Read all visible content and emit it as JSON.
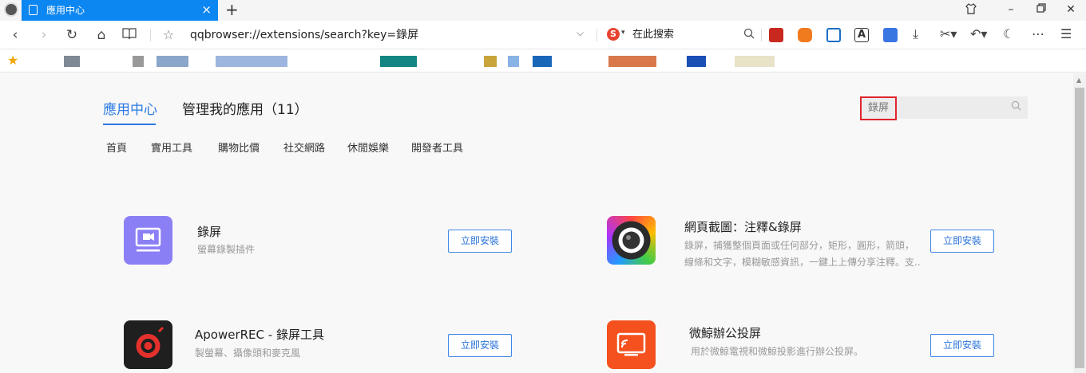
{
  "titlebar": {
    "tab_title": "應用中心",
    "tab_close": "×",
    "new_tab": "+"
  },
  "navbar": {
    "url_text": "qqbrowser://extensions/search?key=錄屏",
    "search_engine_label": "在此搜索",
    "search_engine_badge": "S"
  },
  "page": {
    "tabs": [
      {
        "label": "應用中心",
        "active": true
      },
      {
        "label": "管理我的應用（11）",
        "active": false
      }
    ],
    "search": {
      "value": "錄屏"
    },
    "categories": [
      "首頁",
      "實用工具",
      "購物比價",
      "社交網路",
      "休閒娛樂",
      "開發者工具"
    ],
    "install_label": "立即安裝",
    "apps": [
      {
        "title": "錄屏",
        "desc": [
          "螢幕錄製插件"
        ],
        "icon": "screen-record-icon",
        "icon_color": "#8b7ff5"
      },
      {
        "title": "網頁截圖：注釋&錄屏",
        "desc": [
          "錄屏，捕獲整個頁面或任何部分，矩形，圓形，箭頭，",
          "線條和文字，模糊敏感資訊，一鍵上上傳分享注釋。支.."
        ],
        "icon": "camera-lens-icon",
        "icon_color": "#2b2b2b"
      },
      {
        "title": "ApowerREC - 錄屏工具",
        "desc": [
          "製螢幕、攝像頭和麥克風"
        ],
        "icon": "rec-icon",
        "icon_color": "#1f1f1f"
      },
      {
        "title": "微鯨辦公投屏",
        "desc": [
          "用於微鯨電視和微鯨投影進行辦公投屏。"
        ],
        "icon": "cast-screen-icon",
        "icon_color": "#f4511e"
      }
    ]
  },
  "colors": {
    "tab_blue": "#0c86f0",
    "link_blue": "#2a7ae2",
    "search_highlight": "#e0242c"
  }
}
